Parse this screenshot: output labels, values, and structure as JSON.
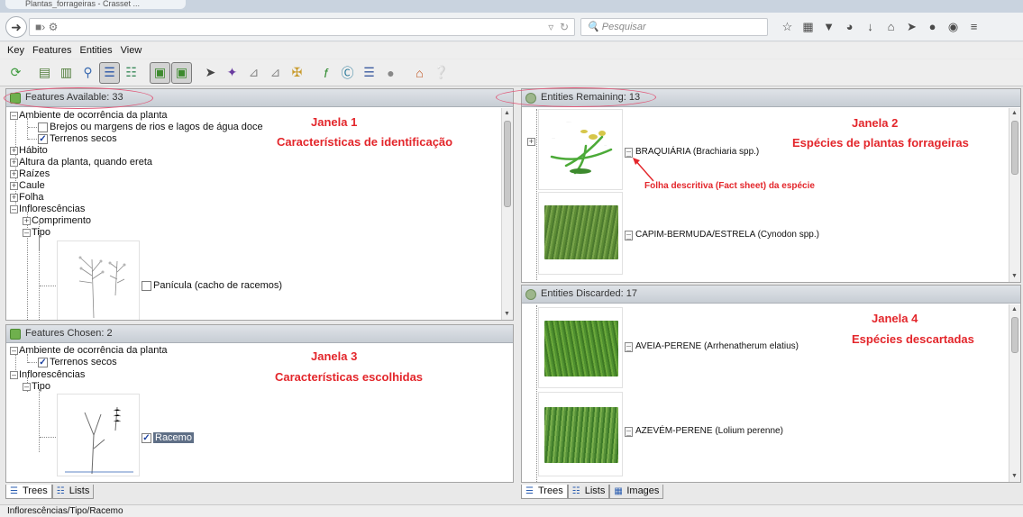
{
  "browser": {
    "tab_title": "Plantas_forrageiras - Crasset ...",
    "search_placeholder": "Pesquisar",
    "toolbar_icons": [
      "star-icon",
      "bookmark-list-icon",
      "pocket-icon",
      "history-icon",
      "download-icon",
      "home-icon",
      "send-icon",
      "chat-icon",
      "shield-icon",
      "menu-icon"
    ]
  },
  "menu": {
    "items": [
      "Key",
      "Features",
      "Entities",
      "View"
    ]
  },
  "features_available": {
    "header": "Features Available: 33",
    "tree": [
      {
        "label": "Ambiente de ocorrência da planta"
      },
      {
        "label": "Brejos ou margens de rios e lagos de água doce",
        "checked": false
      },
      {
        "label": "Terrenos secos",
        "checked": true
      },
      {
        "label": "Hábito"
      },
      {
        "label": "Altura da planta, quando ereta"
      },
      {
        "label": "Raízes"
      },
      {
        "label": "Caule"
      },
      {
        "label": "Folha"
      },
      {
        "label": "Inflorescências"
      },
      {
        "label": "Comprimento"
      },
      {
        "label": "Tipo"
      },
      {
        "label": "Panícula (cacho de racemos)",
        "checked": false
      }
    ],
    "annotation_title": "Janela 1",
    "annotation_sub": "Características de identificação"
  },
  "features_chosen": {
    "header": "Features Chosen: 2",
    "tree": [
      {
        "label": "Ambiente de ocorrência da planta"
      },
      {
        "label": "Terrenos secos",
        "checked": true
      },
      {
        "label": "Inflorescências"
      },
      {
        "label": "Tipo"
      },
      {
        "label": "Racemo",
        "checked": true
      }
    ],
    "annotation_title": "Janela 3",
    "annotation_sub": "Características escolhidas"
  },
  "entities_remaining": {
    "header": "Entities Remaining: 13",
    "items": [
      {
        "label": "BRAQUIÁRIA (Brachiaria spp.)"
      },
      {
        "label": "CAPIM-BERMUDA/ESTRELA (Cynodon spp.)"
      }
    ],
    "annotation_title": "Janela 2",
    "annotation_sub": "Espécies de plantas forrageiras",
    "arrow_note": "Folha descritiva (Fact sheet) da espécie"
  },
  "entities_discarded": {
    "header": "Entities Discarded: 17",
    "items": [
      {
        "label": "AVEIA-PERENE (Arrhenatherum elatius)"
      },
      {
        "label": "AZEVÉM-PERENE (Lolium perenne)"
      }
    ],
    "annotation_title": "Janela 4",
    "annotation_sub": "Espécies descartadas"
  },
  "left_tabs": [
    "Trees",
    "Lists"
  ],
  "right_tabs": [
    "Trees",
    "Lists",
    "Images"
  ],
  "status": "Inflorescências/Tipo/Racemo",
  "colors": {
    "annotation": "#e3262b",
    "ellipse": "#e05a7a",
    "check": "#1a3fa0"
  }
}
